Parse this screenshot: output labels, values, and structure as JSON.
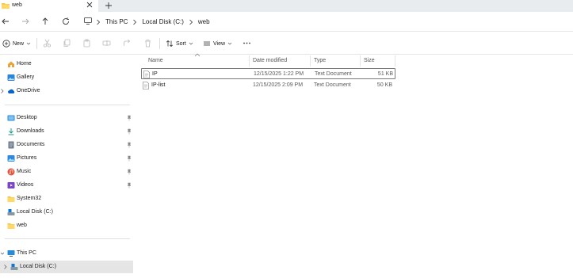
{
  "tab": {
    "title": "web"
  },
  "breadcrumbs": [
    "This PC",
    "Local Disk (C:)",
    "web"
  ],
  "toolbar": {
    "new_label": "New",
    "sort_label": "Sort",
    "view_label": "View"
  },
  "sidebar": {
    "top": [
      {
        "label": "Home",
        "icon": "home-icon"
      },
      {
        "label": "Gallery",
        "icon": "gallery-icon"
      },
      {
        "label": "OneDrive",
        "icon": "onedrive-icon"
      }
    ],
    "quick": [
      {
        "label": "Desktop",
        "icon": "desktop-icon",
        "pinned": true
      },
      {
        "label": "Downloads",
        "icon": "downloads-icon",
        "pinned": true
      },
      {
        "label": "Documents",
        "icon": "documents-icon",
        "pinned": true
      },
      {
        "label": "Pictures",
        "icon": "pictures-icon",
        "pinned": true
      },
      {
        "label": "Music",
        "icon": "music-icon",
        "pinned": true
      },
      {
        "label": "Videos",
        "icon": "videos-icon",
        "pinned": true
      },
      {
        "label": "System32",
        "icon": "folder-icon",
        "pinned": false
      },
      {
        "label": "Local Disk (C:)",
        "icon": "drive-icon",
        "pinned": false
      },
      {
        "label": "web",
        "icon": "folder-icon",
        "pinned": false
      }
    ],
    "bottom": [
      {
        "label": "This PC",
        "icon": "pc-icon"
      },
      {
        "label": "Local Disk (C:)",
        "icon": "drive-icon",
        "selected": true
      }
    ]
  },
  "columns": {
    "name": "Name",
    "date": "Date modified",
    "type": "Type",
    "size": "Size"
  },
  "files": [
    {
      "name": "IP",
      "date": "12/15/2025 1:22 PM",
      "type": "Text Document",
      "size": "51 KB"
    },
    {
      "name": "IP-list",
      "date": "12/15/2025 2:09 PM",
      "type": "Text Document",
      "size": "50 KB"
    }
  ],
  "colors": {
    "folder": "#f4c44a",
    "accent": "#0067c0",
    "selected_bg": "#e5e5e5"
  }
}
